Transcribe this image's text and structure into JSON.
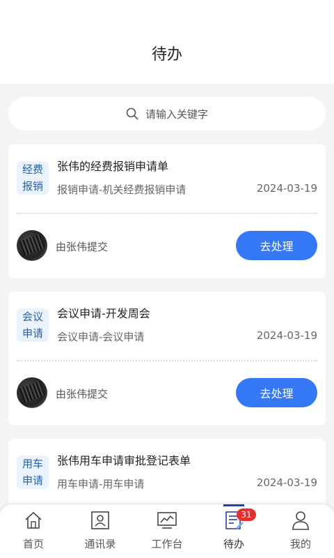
{
  "header": {
    "title": "待办"
  },
  "search": {
    "placeholder": "请输入关键字"
  },
  "cards": [
    {
      "tag": [
        "经费",
        "报销"
      ],
      "title": "张伟的经费报销申请单",
      "subtitle": "报销申请-机关经费报销申请",
      "date": "2024-03-19",
      "submitter": "由张伟提交",
      "action": "去处理"
    },
    {
      "tag": [
        "会议",
        "申请"
      ],
      "title": "会议申请-开发周会",
      "subtitle": "会议申请-会议申请",
      "date": "2024-03-19",
      "submitter": "由张伟提交",
      "action": "去处理"
    },
    {
      "tag": [
        "用车",
        "申请"
      ],
      "title": "张伟用车申请审批登记表单",
      "subtitle": "用车申请-用车申请",
      "date": "2024-03-19"
    }
  ],
  "tabbar": {
    "items": [
      {
        "label": "首页",
        "icon": "home-icon"
      },
      {
        "label": "通讯录",
        "icon": "contacts-icon"
      },
      {
        "label": "工作台",
        "icon": "workbench-icon"
      },
      {
        "label": "待办",
        "icon": "todo-icon",
        "badge": "31",
        "active": true
      },
      {
        "label": "我的",
        "icon": "profile-icon"
      }
    ]
  },
  "colors": {
    "accent": "#3478f6",
    "tag_bg": "#eaf3fd",
    "tag_text": "#2a5fa7",
    "badge": "#e53030"
  }
}
